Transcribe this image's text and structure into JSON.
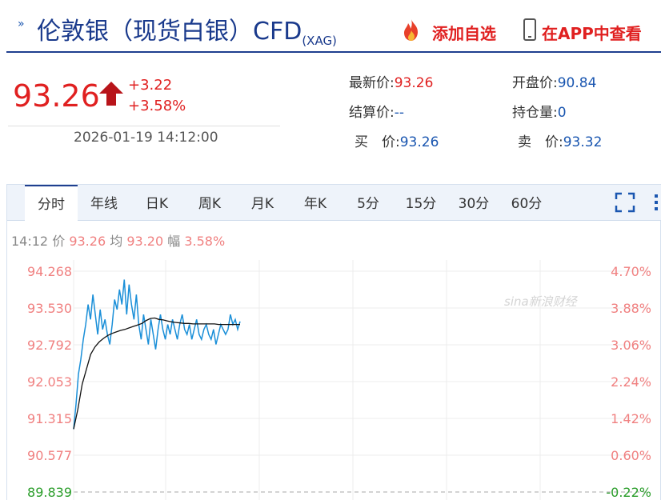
{
  "header": {
    "title": "伦敦银（现货白银）CFD",
    "subtitle": "(XAG)",
    "add_favorite": "添加自选",
    "view_in_app": "在APP中查看"
  },
  "quote": {
    "price": "93.26",
    "change": "+3.22",
    "change_pct": "+3.58%",
    "timestamp": "2026-01-19 14:12:00"
  },
  "stats": {
    "latest_label": "最新价:",
    "latest_value": "93.26",
    "open_label": "开盘价:",
    "open_value": "90.84",
    "settle_label": "结算价:",
    "settle_value": "--",
    "oi_label": "持仓量:",
    "oi_value": "0",
    "bid_label": "买　价:",
    "bid_value": "93.26",
    "ask_label": "卖　价:",
    "ask_value": "93.32"
  },
  "tabs": [
    "分时",
    "年线",
    "日K",
    "周K",
    "月K",
    "年K",
    "5分",
    "15分",
    "30分",
    "60分"
  ],
  "active_tab": "分时",
  "status_bar": {
    "time": "14:12",
    "price_label": "价",
    "price": "93.26",
    "avg_label": "均",
    "avg": "93.20",
    "amp_label": "幅",
    "amp": "3.58%"
  },
  "watermark": "sina新浪财经",
  "colors": {
    "up": "#e02020",
    "blue": "#1a56b0",
    "price_line": "#1a8fd8",
    "avg_line": "#111111",
    "axis_text": "#f08080"
  },
  "chart_data": {
    "type": "line",
    "y_left_ticks": [
      "94.268",
      "93.530",
      "92.792",
      "92.053",
      "91.315",
      "90.577",
      "89.839"
    ],
    "y_right_ticks": [
      "4.70%",
      "3.88%",
      "3.06%",
      "2.24%",
      "1.42%",
      "0.60%",
      "-0.22%"
    ],
    "ylim": [
      89.839,
      94.268
    ],
    "grid": true,
    "series": [
      {
        "values": [
          91.1,
          91.6,
          92.2,
          92.5,
          92.9,
          93.2,
          93.6,
          93.3,
          93.8,
          93.4,
          93.0,
          93.5,
          93.1,
          93.3,
          93.0,
          92.8,
          93.2,
          93.7,
          93.5,
          93.9,
          93.6,
          94.1,
          93.4,
          94.0,
          93.6,
          93.3,
          93.8,
          93.2,
          92.9,
          93.4,
          93.1,
          92.8,
          93.3,
          93.0,
          92.7,
          93.1,
          93.4,
          93.1,
          92.9,
          93.2,
          93.0,
          93.3,
          93.1,
          92.9,
          93.2,
          93.4,
          93.1,
          93.0,
          93.2,
          92.9,
          93.1,
          93.3,
          93.0,
          92.9,
          93.1,
          93.2,
          93.0,
          92.9,
          93.1,
          92.8,
          93.0,
          93.2,
          93.1,
          93.0,
          93.1,
          93.4,
          93.2,
          93.3,
          93.1,
          93.26
        ]
      },
      {
        "values": [
          91.1,
          91.5,
          92.0,
          92.3,
          92.6,
          92.75,
          92.85,
          92.92,
          92.98,
          93.02,
          93.05,
          93.08,
          93.1,
          93.13,
          93.16,
          93.19,
          93.22,
          93.28,
          93.32,
          93.33,
          93.3,
          93.29,
          93.27,
          93.25,
          93.24,
          93.23,
          93.22,
          93.22,
          93.21,
          93.21,
          93.21,
          93.21,
          93.21,
          93.21,
          93.2,
          93.2,
          93.2,
          93.2,
          93.2,
          93.2
        ]
      }
    ]
  }
}
